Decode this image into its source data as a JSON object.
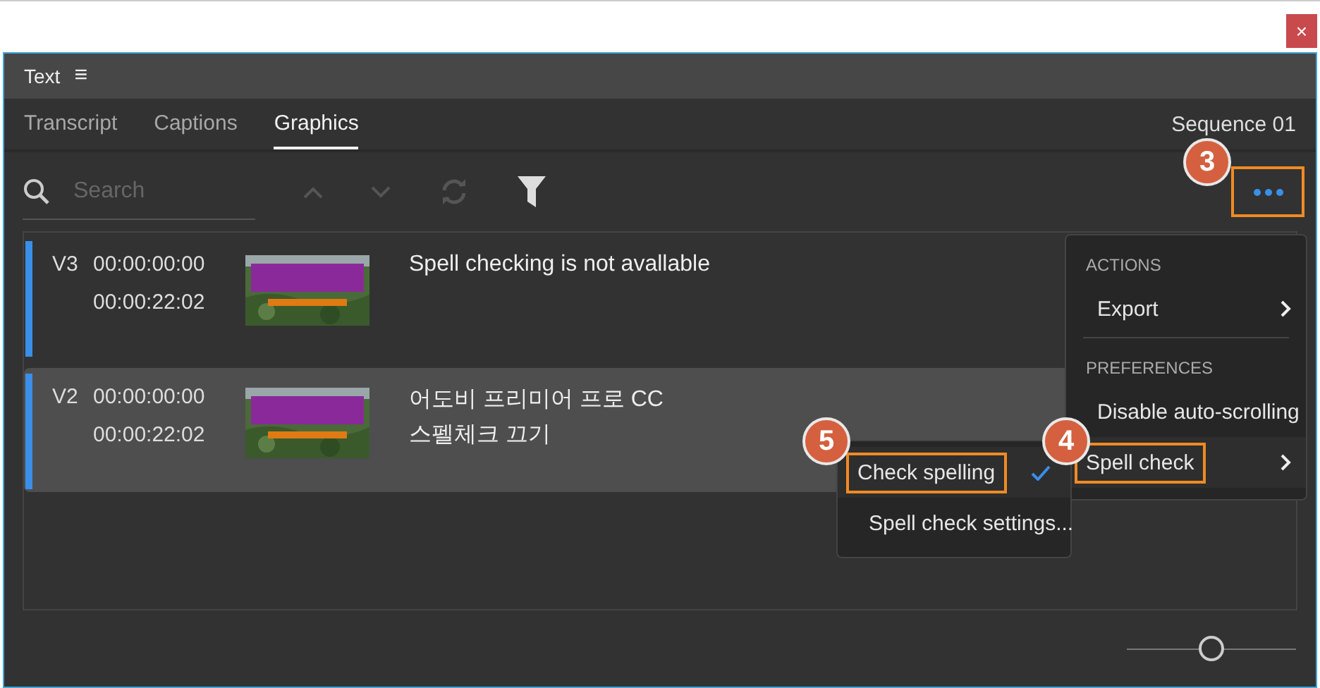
{
  "window": {
    "close_glyph": "×"
  },
  "panel": {
    "title": "Text",
    "menu_glyph": "≡"
  },
  "tabs": [
    {
      "label": "Transcript",
      "selected": false
    },
    {
      "label": "Captions",
      "selected": false
    },
    {
      "label": "Graphics",
      "selected": true
    }
  ],
  "sequence": "Sequence 01",
  "search": {
    "placeholder": "Search"
  },
  "more_button": {
    "highlighted": true,
    "callout": "3"
  },
  "items": [
    {
      "track": "V3",
      "start": "00:00:00:00",
      "end": "00:00:22:02",
      "lines": [
        "Spell checking is not avallable"
      ],
      "selected": false,
      "thumbnail": {
        "kind": "picture"
      }
    },
    {
      "track": "V2",
      "start": "00:00:00:00",
      "end": "00:00:22:02",
      "lines": [
        "어도비 프리미어 프로 CC",
        "스펠체크 끄기"
      ],
      "selected": true,
      "thumbnail": {
        "kind": "picture"
      }
    }
  ],
  "menu": {
    "sections": [
      {
        "heading": "ACTIONS",
        "items": [
          {
            "label": "Export",
            "submenu": true,
            "highlighted": false
          }
        ]
      },
      {
        "heading": "PREFERENCES",
        "items": [
          {
            "label": "Disable auto-scrolling",
            "submenu": false,
            "highlighted": false
          },
          {
            "label": "Spell check",
            "submenu": true,
            "highlighted": true,
            "callout": "4"
          }
        ]
      }
    ]
  },
  "submenu": {
    "items": [
      {
        "label": "Check spelling",
        "checked": true,
        "highlighted": true,
        "callout": "5"
      },
      {
        "label": "Spell check settings...",
        "checked": false,
        "highlighted": false
      }
    ]
  },
  "zoom_slider": {
    "level": 0.5
  }
}
